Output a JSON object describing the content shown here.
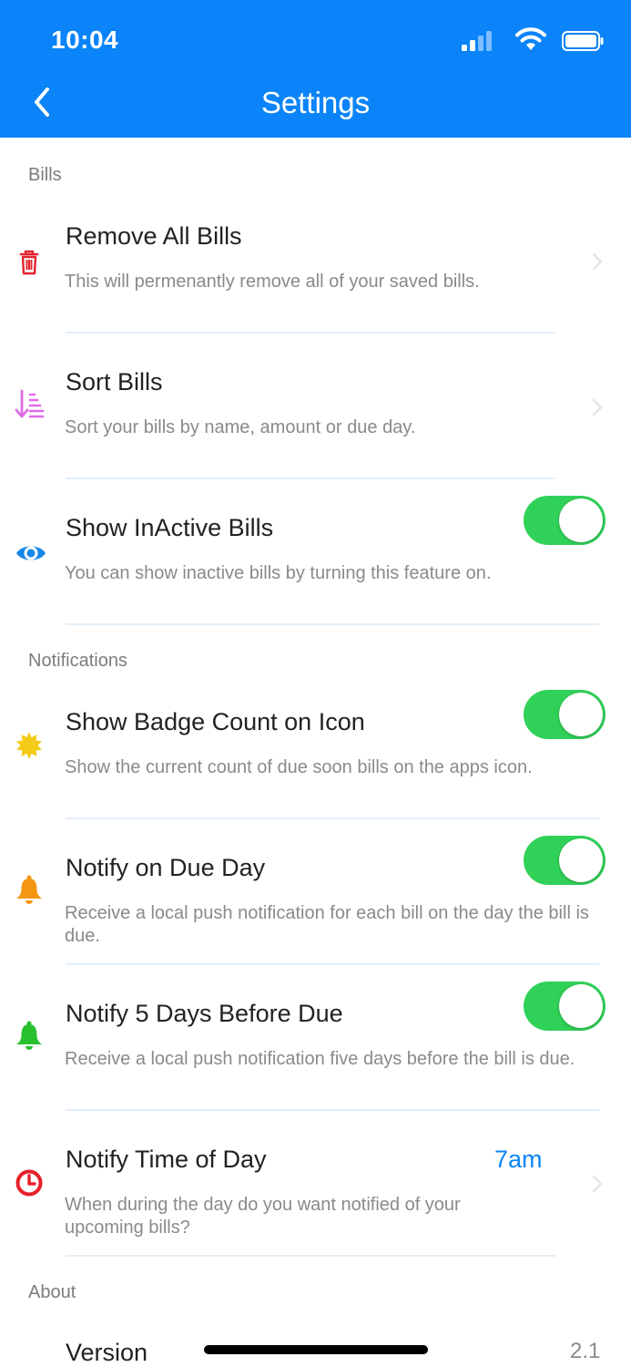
{
  "status_bar": {
    "time": "10:04"
  },
  "nav": {
    "title": "Settings"
  },
  "sections": {
    "bills": "Bills",
    "notifications": "Notifications",
    "about": "About"
  },
  "rows": {
    "remove_all": {
      "title": "Remove All Bills",
      "desc": "This will permenantly remove all of your saved bills."
    },
    "sort": {
      "title": "Sort Bills",
      "desc": "Sort your bills by name, amount or due day."
    },
    "show_inactive": {
      "title": "Show InActive Bills",
      "desc": "You can show inactive bills by turning this feature on.",
      "enabled": true
    },
    "badge_count": {
      "title": "Show Badge Count on Icon",
      "desc": "Show the current count of due soon bills on the apps icon.",
      "enabled": true
    },
    "notify_due": {
      "title": "Notify on Due Day",
      "desc": "Receive a local push notification for each bill on the day the bill is due.",
      "enabled": true
    },
    "notify_5_days": {
      "title": "Notify 5 Days Before Due",
      "desc": "Receive a local push notification five days before the bill is due.",
      "enabled": true
    },
    "notify_time": {
      "title": "Notify Time of Day",
      "value": "7am",
      "desc": "When during the day do you want notified of your upcoming bills?"
    },
    "version": {
      "title": "Version",
      "value": "2.1"
    }
  },
  "colors": {
    "nav_bar": "#0a84f8",
    "toggle_on": "#30d158",
    "trash_icon": "#e0242e",
    "sort_icon": "#e06be6",
    "eye_icon": "#1688e8",
    "sun_icon": "#f4cc17",
    "bell_orange": "#f4960f",
    "bell_green": "#27c02f",
    "clock_icon": "#e8202a"
  },
  "icons": {
    "remove_all": "trash-icon",
    "sort": "sort-icon",
    "show_inactive": "eye-icon",
    "badge_count": "sun-icon",
    "notify_due": "bell-icon",
    "notify_5_days": "bell-icon",
    "notify_time": "clock-icon"
  }
}
